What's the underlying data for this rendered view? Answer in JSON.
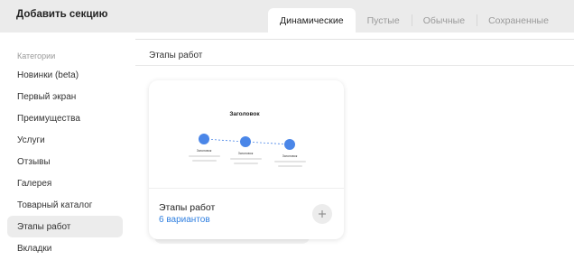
{
  "header": {
    "title": "Добавить секцию",
    "tabs": [
      {
        "label": "Динамические",
        "active": true
      },
      {
        "label": "Пустые",
        "active": false
      },
      {
        "label": "Обычные",
        "active": false
      },
      {
        "label": "Сохраненные",
        "active": false
      }
    ]
  },
  "sidebar": {
    "heading": "Категории",
    "items": [
      {
        "label": "Новинки (beta)"
      },
      {
        "label": "Первый экран"
      },
      {
        "label": "Преимущества"
      },
      {
        "label": "Услуги"
      },
      {
        "label": "Отзывы"
      },
      {
        "label": "Галерея"
      },
      {
        "label": "Товарный каталог"
      },
      {
        "label": "Этапы работ",
        "active": true
      },
      {
        "label": "Вкладки"
      }
    ]
  },
  "main": {
    "section_title": "Этапы работ",
    "card": {
      "name": "Этапы работ",
      "variants": "6 вариантов",
      "preview": {
        "title": "Заголовок",
        "step_labels": [
          "Заголовок",
          "Заголовок",
          "Заголовок"
        ],
        "accent_color": "#4a86e8"
      },
      "add_icon": "plus-icon"
    }
  },
  "colors": {
    "accent": "#4a86e8",
    "link": "#2f7fe0",
    "header_bg": "#ebebeb",
    "active_item_bg": "#ececec"
  }
}
